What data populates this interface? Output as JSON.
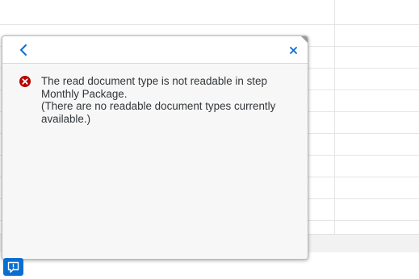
{
  "popover": {
    "message": {
      "severity": "error",
      "icon": "error-icon",
      "icon_color": "#bb0000",
      "lines": [
        "The read document type is not readable in step",
        "Monthly Package.",
        "(There are no readable document types currently",
        "available.)"
      ]
    },
    "header": {
      "back_icon": "chevron-left-icon",
      "close_icon": "close-icon",
      "icon_color": "#0a6ed1"
    }
  },
  "footer": {
    "message_trigger_icon": "message-popup-icon",
    "accent": "#0a6ed1"
  }
}
